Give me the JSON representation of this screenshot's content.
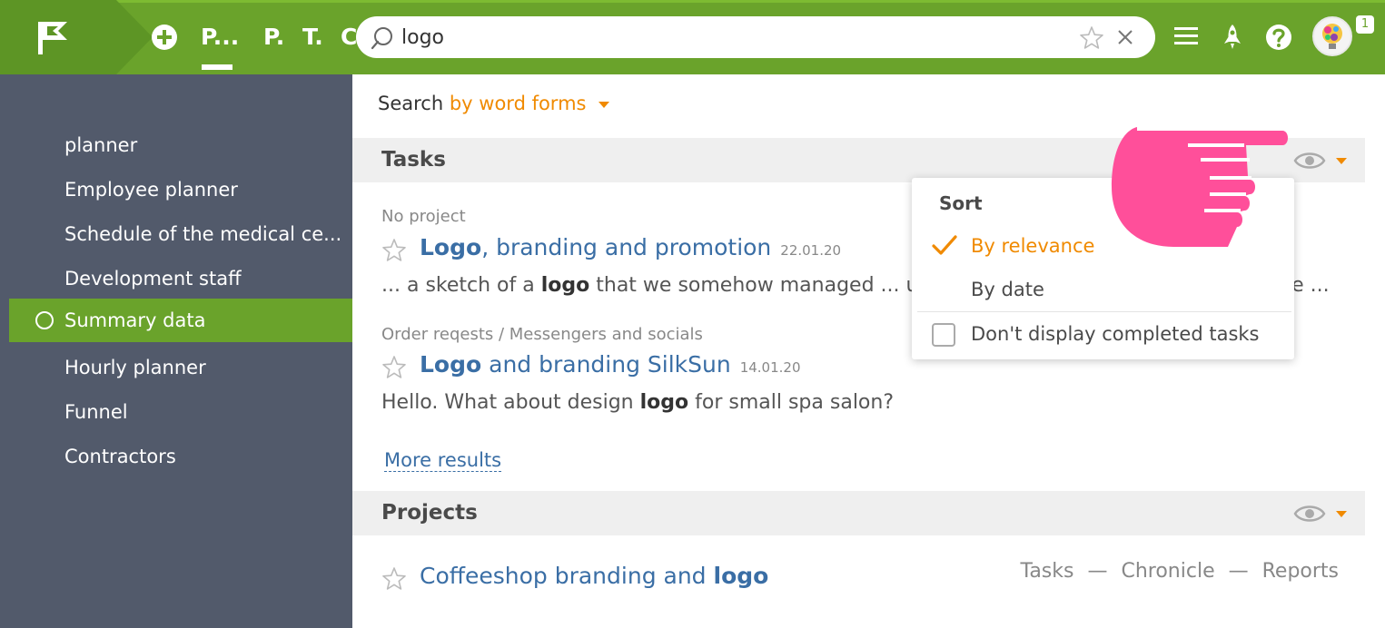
{
  "topbar": {
    "nav_tabs": [
      {
        "label": "P..."
      },
      {
        "label": "P."
      },
      {
        "label": "T."
      },
      {
        "label": "C."
      }
    ],
    "search": {
      "value": "logo",
      "placeholder": ""
    },
    "avatar_badge": "1",
    "icons": [
      "flag-logo-icon",
      "plus-circle-icon",
      "search-icon",
      "star-icon",
      "close-icon",
      "menu-icon",
      "rocket-icon",
      "help-icon"
    ]
  },
  "sidebar": {
    "items": [
      {
        "label": "planner"
      },
      {
        "label": "Employee planner"
      },
      {
        "label": "Schedule of the medical ce..."
      },
      {
        "label": "Development staff"
      },
      {
        "label": "Summary data",
        "active": true
      },
      {
        "label": "Hourly planner"
      },
      {
        "label": "Funnel"
      },
      {
        "label": "Contractors"
      }
    ]
  },
  "main": {
    "search_mode": {
      "label": "Search",
      "value": "by word forms"
    },
    "tasks_section": {
      "title": "Tasks",
      "results": [
        {
          "meta": "No project",
          "title_bold": "Logo",
          "title_rest": ", branding and promotion",
          "date": "22.01.20",
          "snippet_pre": "... a sketch of a ",
          "snippet_bold": "logo",
          "snippet_post": " that we somehow managed ... up",
          "snippet_tail": "ote ..."
        },
        {
          "meta": "Order reqests / Messengers and socials",
          "title_bold": "Logo",
          "title_rest": " and branding SilkSun",
          "date": "14.01.20",
          "snippet_pre": "Hello. What about design ",
          "snippet_bold": "logo",
          "snippet_post": " for small spa salon?"
        }
      ],
      "more_results": "More results"
    },
    "projects_section": {
      "title": "Projects",
      "results": [
        {
          "title_rest": "Coffeeshop branding and ",
          "title_bold": "logo",
          "links": [
            "Tasks",
            "Chronicle",
            "Reports"
          ],
          "separator": "—"
        }
      ]
    }
  },
  "sort_dropdown": {
    "title": "Sort",
    "options": [
      {
        "label": "By relevance",
        "selected": true
      },
      {
        "label": "By date",
        "selected": false
      }
    ],
    "checkbox_label": "Don't display completed tasks",
    "checkbox_checked": false
  },
  "colors": {
    "topbar": "#6aa32b",
    "sidebar": "#525a6b",
    "accent": "#f08a00",
    "link": "#3a6ea5",
    "hand": "#ff4f9a"
  }
}
